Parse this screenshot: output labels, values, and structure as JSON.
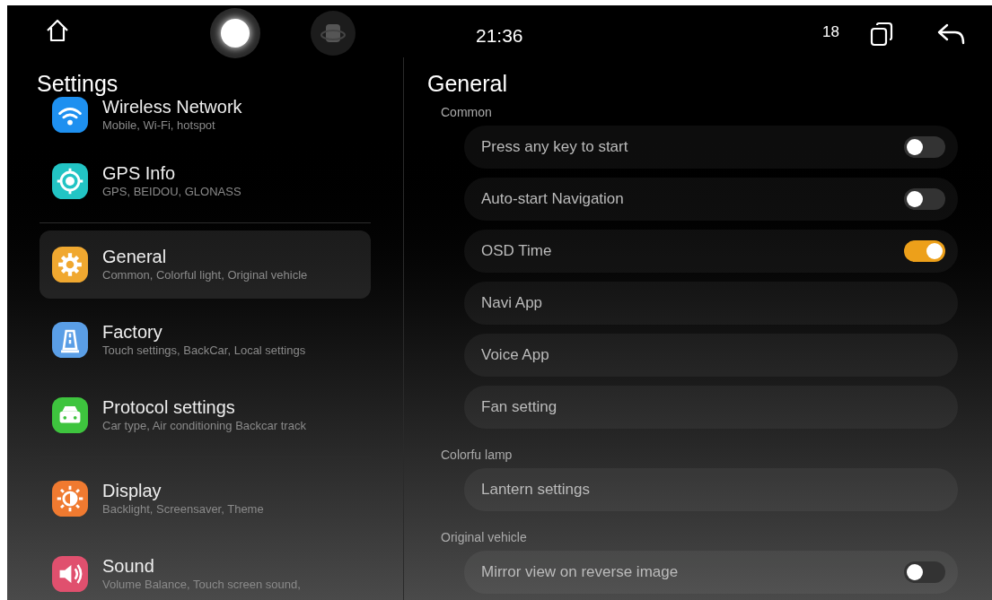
{
  "status_bar": {
    "time": "21:36",
    "badge": "18"
  },
  "sidebar": {
    "title": "Settings",
    "items": [
      {
        "title": "Wireless Network",
        "subtitle": "Mobile,  Wi-Fi, hotspot",
        "color": "#1e90f0",
        "selected": false
      },
      {
        "title": "GPS Info",
        "subtitle": "GPS, BEIDOU, GLONASS",
        "color": "#22c4c4",
        "selected": false
      },
      {
        "title": "General",
        "subtitle": "Common, Colorful light, Original vehicle",
        "color": "#f0a830",
        "selected": true
      },
      {
        "title": "Factory",
        "subtitle": "Touch settings, BackCar, Local settings",
        "color": "#5a9ee6",
        "selected": false
      },
      {
        "title": "Protocol settings",
        "subtitle": "Car type, Air conditioning  Backcar track",
        "color": "#3ec43e",
        "selected": false
      },
      {
        "title": "Display",
        "subtitle": "Backlight, Screensaver, Theme",
        "color": "#f07a30",
        "selected": false
      },
      {
        "title": "Sound",
        "subtitle": "Volume Balance, Touch screen sound,",
        "color": "#e0506e",
        "selected": false
      }
    ]
  },
  "panel": {
    "title": "General",
    "sections": [
      {
        "label": "Common",
        "rows": [
          {
            "kind": "toggle",
            "label": "Press any key to start",
            "on": false
          },
          {
            "kind": "toggle",
            "label": "Auto-start Navigation",
            "on": false
          },
          {
            "kind": "toggle",
            "label": "OSD Time",
            "on": true
          },
          {
            "kind": "link",
            "label": "Navi App"
          },
          {
            "kind": "link",
            "label": "Voice App"
          },
          {
            "kind": "link",
            "label": "Fan setting"
          }
        ]
      },
      {
        "label": "Colorfu  lamp",
        "rows": [
          {
            "kind": "link",
            "label": "Lantern settings"
          }
        ]
      },
      {
        "label": "Original vehicle",
        "rows": [
          {
            "kind": "toggle",
            "label": "Mirror view on reverse image",
            "on": false
          }
        ]
      }
    ]
  }
}
